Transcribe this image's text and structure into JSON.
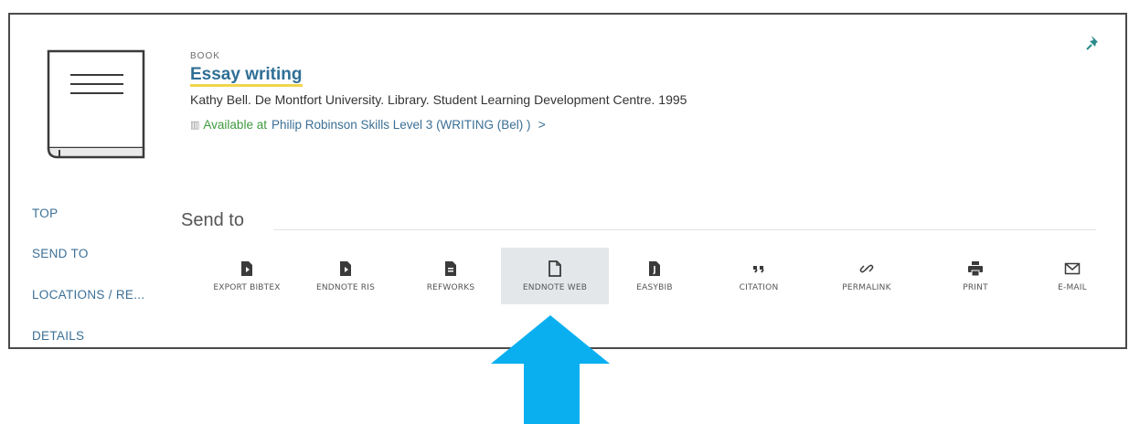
{
  "record": {
    "type_label": "BOOK",
    "title": "Essay writing",
    "authors": "Kathy Bell. De Montfort University. Library. Student Learning Development Centre. 1995",
    "availability": {
      "status": "Available at",
      "location": "Philip Robinson  Skills Level 3 (WRITING (Bel) )",
      "chevron": ">"
    }
  },
  "side_nav": {
    "items": [
      {
        "label": "TOP"
      },
      {
        "label": "SEND TO"
      },
      {
        "label": "LOCATIONS / RE..."
      },
      {
        "label": "DETAILS"
      }
    ]
  },
  "send_to": {
    "heading": "Send to",
    "actions": [
      {
        "label": "EXPORT BIBTEX",
        "icon": "bibtex-file-icon"
      },
      {
        "label": "ENDNOTE RIS",
        "icon": "ris-file-icon"
      },
      {
        "label": "REFWORKS",
        "icon": "refworks-file-icon"
      },
      {
        "label": "ENDNOTE WEB",
        "icon": "endnote-web-file-icon",
        "active": true
      },
      {
        "label": "EASYBIB",
        "icon": "easybib-file-icon"
      },
      {
        "label": "CITATION",
        "icon": "quote-icon"
      },
      {
        "label": "PERMALINK",
        "icon": "link-icon"
      },
      {
        "label": "PRINT",
        "icon": "printer-icon"
      },
      {
        "label": "E-MAIL",
        "icon": "envelope-icon"
      }
    ]
  },
  "colors": {
    "link": "#3b6f95",
    "available": "#3f9a3f",
    "highlight": "#f1d54d",
    "arrow": "#0aaff0",
    "pin": "#2b8a8a"
  }
}
